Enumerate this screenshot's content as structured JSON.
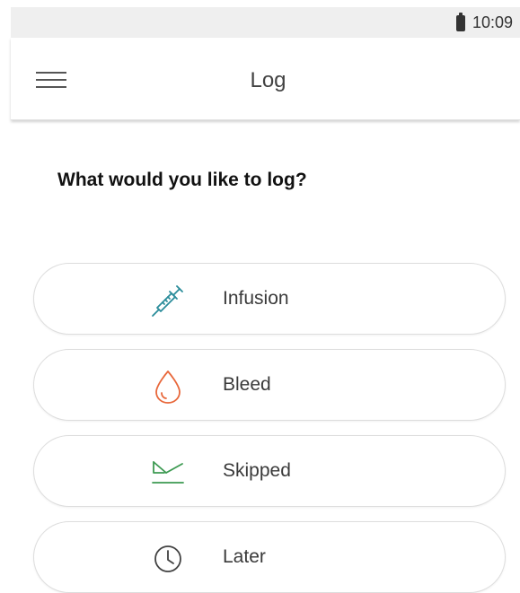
{
  "status_bar": {
    "time": "10:09",
    "battery_icon": "battery-icon"
  },
  "app_bar": {
    "title": "Log",
    "menu_icon": "hamburger-menu-icon"
  },
  "prompt": "What would you like to log?",
  "options": [
    {
      "label": "Infusion",
      "icon": "syringe-icon",
      "color": "#2a8c9a"
    },
    {
      "label": "Bleed",
      "icon": "drop-icon",
      "color": "#e8673a"
    },
    {
      "label": "Skipped",
      "icon": "skipped-icon",
      "color": "#3d9a52"
    },
    {
      "label": "Later",
      "icon": "clock-icon",
      "color": "#424242"
    }
  ]
}
